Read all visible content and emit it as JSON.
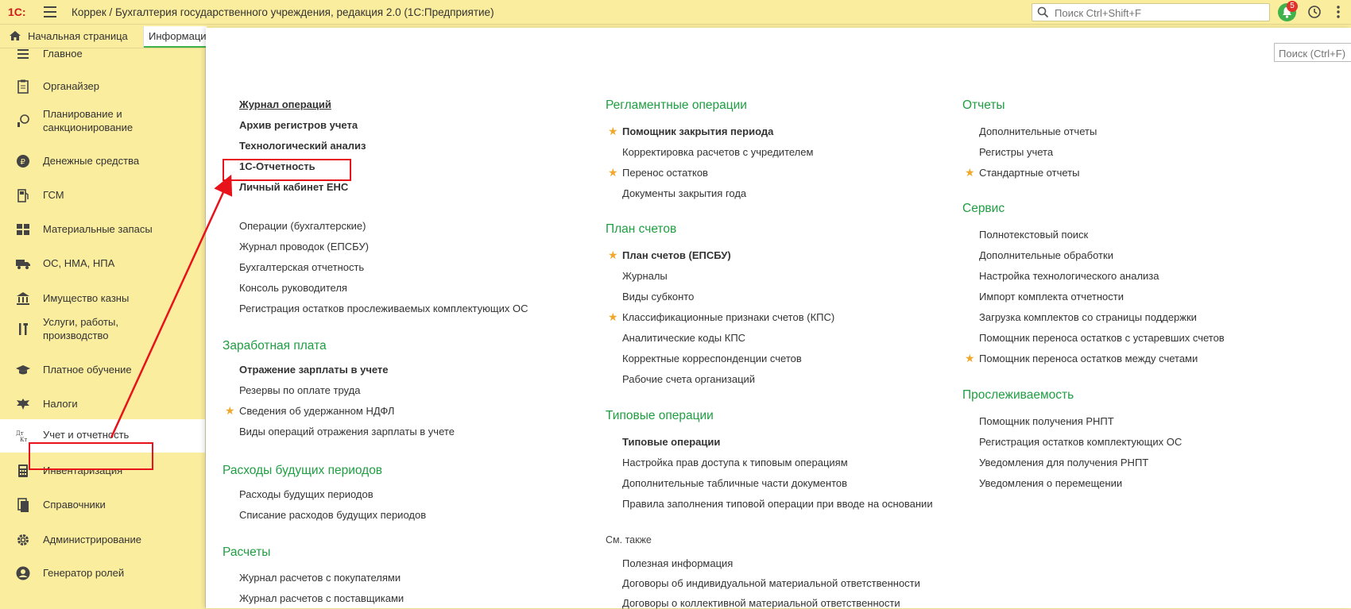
{
  "titlebar": {
    "logo": "1С:",
    "title": "Коррек / Бухгалтерия государственного учреждения, редакция 2.0  (1С:Предприятие)",
    "search_placeholder": "Поиск Ctrl+Shift+F",
    "notifications_count": "5"
  },
  "tabs": {
    "home": "Начальная страница",
    "info": "Информация"
  },
  "sidebar": {
    "items": [
      {
        "label": "Главное",
        "icon": "menu-lines-icon"
      },
      {
        "label": "Органайзер",
        "icon": "clipboard-icon"
      },
      {
        "label": "Планирование и\nсанкционирование",
        "icon": "planning-icon"
      },
      {
        "label": "Денежные средства",
        "icon": "ruble-coin-icon"
      },
      {
        "label": "ГСМ",
        "icon": "fuel-icon"
      },
      {
        "label": "Материальные запасы",
        "icon": "grid-blocks-icon"
      },
      {
        "label": "ОС, НМА, НПА",
        "icon": "truck-icon"
      },
      {
        "label": "Имущество казны",
        "icon": "bank-building-icon"
      },
      {
        "label": "Услуги, работы,\nпроизводство",
        "icon": "tools-icon"
      },
      {
        "label": "Платное обучение",
        "icon": "graduation-cap-icon"
      },
      {
        "label": "Налоги",
        "icon": "eagle-emblem-icon"
      },
      {
        "label": "Учет и отчетность",
        "icon": "debit-credit-icon",
        "active": true
      },
      {
        "label": "Инвентаризация",
        "icon": "calculator-icon"
      },
      {
        "label": "Справочники",
        "icon": "books-icon"
      },
      {
        "label": "Администрирование",
        "icon": "gear-icon"
      },
      {
        "label": "Генератор ролей",
        "icon": "user-gear-icon"
      }
    ]
  },
  "panel": {
    "search_placeholder": "Поиск (Ctrl+F)",
    "col1": {
      "top_links": [
        "Журнал операций",
        "Архив регистров учета",
        "Технологический анализ",
        "1С-Отчетность",
        "Личный кабинет ЕНС"
      ],
      "links2": [
        "Операции (бухгалтерские)",
        "Журнал проводок (ЕПСБУ)",
        "Бухгалтерская отчетность",
        "Консоль руководителя",
        "Регистрация остатков прослеживаемых комплектующих ОС"
      ],
      "salary_title": "Заработная плата",
      "salary_links": [
        "Отражение зарплаты в учете",
        "Резервы по оплате труда",
        "Сведения об удержанном НДФЛ",
        "Виды операций отражения зарплаты в учете"
      ],
      "deferred_title": "Расходы будущих периодов",
      "deferred_links": [
        "Расходы будущих периодов",
        "Списание расходов будущих периодов"
      ],
      "settlements_title": "Расчеты",
      "settlements_links": [
        "Журнал расчетов с покупателями",
        "Журнал расчетов с поставщиками"
      ]
    },
    "col2": {
      "reg_title": "Регламентные операции",
      "reg_links": [
        "Помощник закрытия периода",
        "Корректировка расчетов с учредителем",
        "Перенос остатков",
        "Документы закрытия года"
      ],
      "plan_title": "План счетов",
      "plan_links": [
        "План счетов (ЕПСБУ)",
        "Журналы",
        "Виды субконто",
        "Классификационные признаки счетов (КПС)",
        "Аналитические коды КПС",
        "Корректные корреспонденции счетов",
        "Рабочие счета организаций"
      ],
      "typical_title": "Типовые операции",
      "typical_links": [
        "Типовые операции",
        "Настройка прав доступа к типовым операциям",
        "Дополнительные табличные части документов",
        "Правила заполнения типовой операции при вводе на основании"
      ],
      "see_also": "См. также",
      "see_also_links": [
        "Полезная информация",
        "Договоры об индивидуальной материальной ответственности",
        "Договоры о коллективной материальной ответственности"
      ]
    },
    "col3": {
      "reports_title": "Отчеты",
      "reports_links": [
        "Дополнительные отчеты",
        "Регистры учета",
        "Стандартные отчеты"
      ],
      "service_title": "Сервис",
      "service_links": [
        "Полнотекстовый поиск",
        "Дополнительные обработки",
        "Настройка технологического анализа",
        "Импорт комплекта отчетности",
        "Загрузка комплектов со страницы поддержки",
        "Помощник переноса остатков с устаревших счетов",
        "Помощник переноса остатков между счетами"
      ],
      "trace_title": "Прослеживаемость",
      "trace_links": [
        "Помощник получения РНПТ",
        "Регистрация остатков комплектующих ОС",
        "Уведомления для получения РНПТ",
        "Уведомления о перемещении"
      ]
    }
  },
  "colors": {
    "sidebar_bg": "#fbed9e",
    "section_green": "#1f9e42",
    "star": "#f0a82b",
    "annotation_red": "#e8121b"
  }
}
